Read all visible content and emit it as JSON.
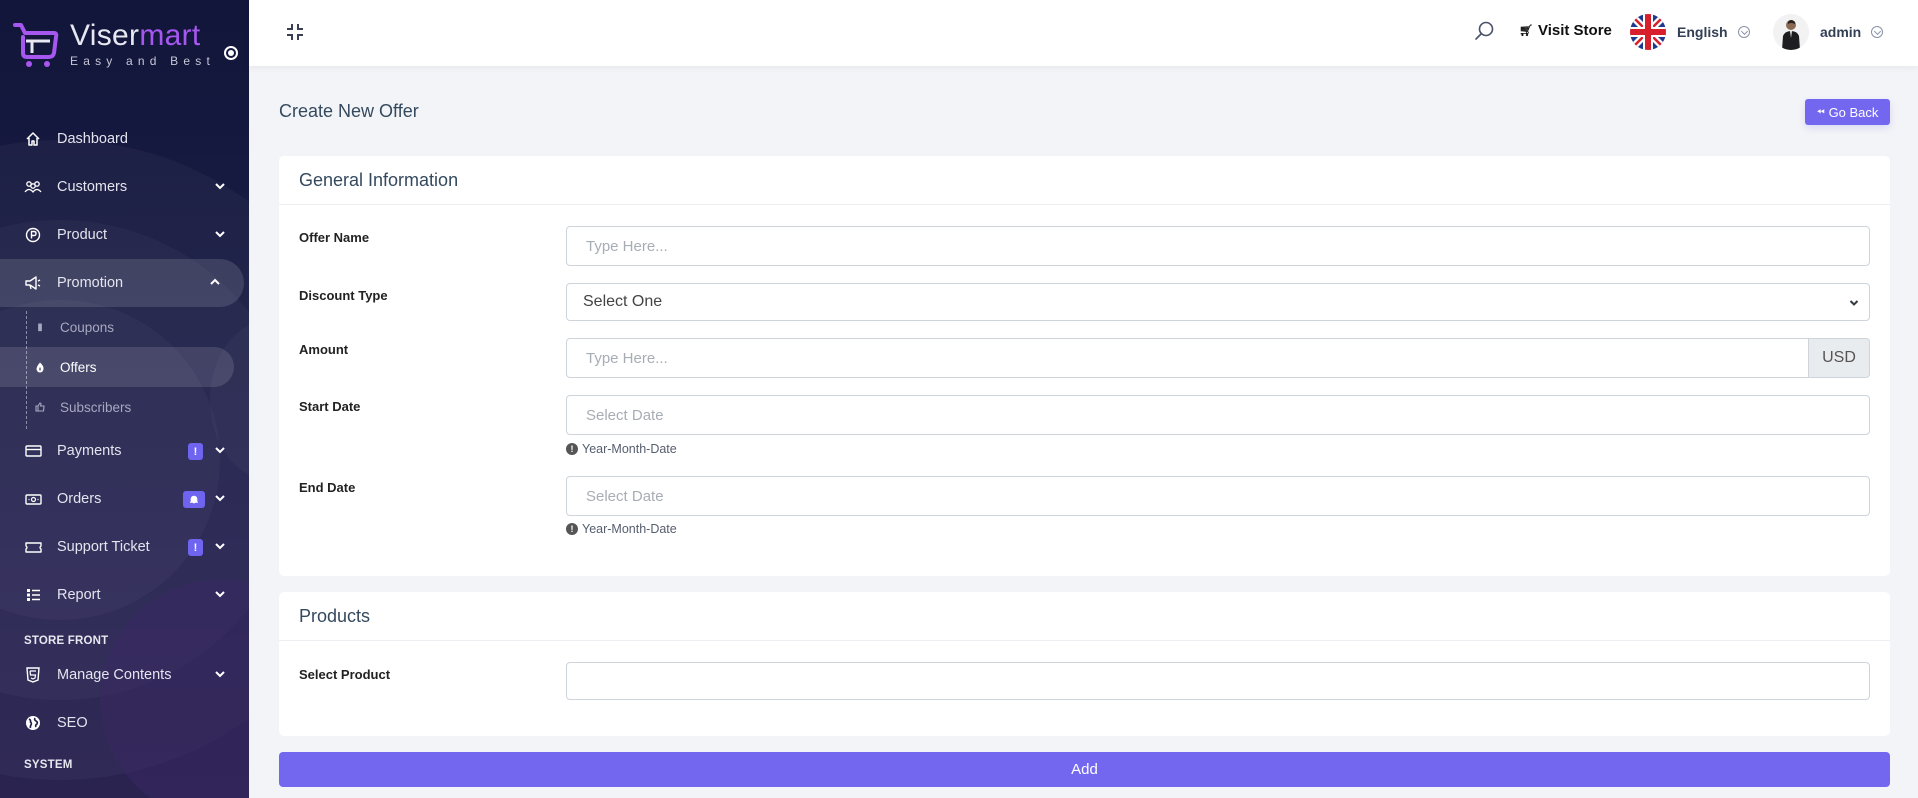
{
  "brand": {
    "name_part1": "Viser",
    "name_part2": "mart",
    "tagline": "Easy and Best",
    "accent_color": "#a657f0"
  },
  "sidebar": {
    "items": [
      {
        "label": "Dashboard",
        "icon": "home-icon"
      },
      {
        "label": "Customers",
        "icon": "users-icon",
        "caret": "down"
      },
      {
        "label": "Product",
        "icon": "product-p-icon",
        "caret": "down"
      },
      {
        "label": "Promotion",
        "icon": "megaphone-icon",
        "caret": "up",
        "active": true,
        "children": [
          {
            "label": "Coupons",
            "icon": "coupon-icon"
          },
          {
            "label": "Offers",
            "icon": "fire-icon",
            "active": true
          },
          {
            "label": "Subscribers",
            "icon": "thumbs-up-icon"
          }
        ]
      },
      {
        "label": "Payments",
        "icon": "credit-card-icon",
        "caret": "down",
        "badge": "!"
      },
      {
        "label": "Orders",
        "icon": "money-bill-icon",
        "caret": "down",
        "badge": "bell"
      },
      {
        "label": "Support Ticket",
        "icon": "ticket-icon",
        "caret": "down",
        "badge": "!"
      },
      {
        "label": "Report",
        "icon": "list-icon",
        "caret": "down"
      }
    ],
    "sections": [
      {
        "title": "STORE FRONT",
        "items": [
          {
            "label": "Manage Contents",
            "icon": "html5-icon",
            "caret": "down"
          },
          {
            "label": "SEO",
            "icon": "globe-icon"
          }
        ]
      },
      {
        "title": "SYSTEM"
      }
    ]
  },
  "topbar": {
    "visit_store": "Visit Store",
    "language": "English",
    "user": "admin"
  },
  "page": {
    "title": "Create New Offer",
    "go_back": "Go Back"
  },
  "general": {
    "title": "General Information",
    "offer_name": {
      "label": "Offer Name",
      "placeholder": "Type Here...",
      "value": ""
    },
    "discount_type": {
      "label": "Discount Type",
      "selected": "Select One"
    },
    "amount": {
      "label": "Amount",
      "placeholder": "Type Here...",
      "value": "",
      "currency": "USD"
    },
    "start_date": {
      "label": "Start Date",
      "placeholder": "Select Date",
      "value": "",
      "hint": "Year-Month-Date"
    },
    "end_date": {
      "label": "End Date",
      "placeholder": "Select Date",
      "value": "",
      "hint": "Year-Month-Date"
    }
  },
  "products": {
    "title": "Products",
    "select_product": {
      "label": "Select Product",
      "value": ""
    }
  },
  "actions": {
    "add": "Add"
  },
  "colors": {
    "primary": "#7367f0",
    "sidebar_bg": "#12163a",
    "page_bg": "#f3f4f7"
  }
}
